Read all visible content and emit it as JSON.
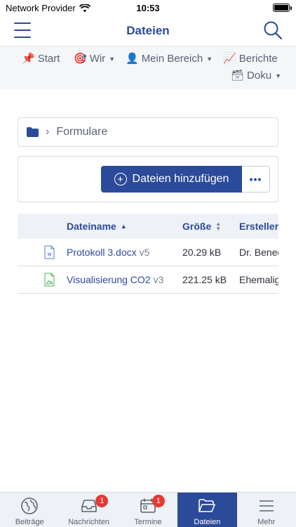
{
  "status_bar": {
    "carrier": "Network Provider",
    "time": "10:53"
  },
  "header": {
    "title": "Dateien"
  },
  "nav": {
    "items": [
      {
        "label": "Start",
        "icon": "📌"
      },
      {
        "label": "Wir",
        "icon": "🎯"
      },
      {
        "label": "Mein Bereich",
        "icon": "👤"
      },
      {
        "label": "Berichte",
        "icon": "📈"
      },
      {
        "label": "Doku",
        "icon": "🗃"
      }
    ]
  },
  "breadcrumb": {
    "current": "Formulare"
  },
  "toolbar": {
    "add_label": "Dateien hinzufügen",
    "more_label": "•••"
  },
  "table": {
    "columns": [
      "Dateiname",
      "Größe",
      "Ersteller"
    ],
    "rows": [
      {
        "name": "Protokoll 3.docx",
        "version": "v5",
        "size": "20.29 kB",
        "creator": "Dr. Benedikt",
        "type": "word"
      },
      {
        "name": "Visualisierung CO2",
        "version": "v3",
        "size": "221.25 kB",
        "creator": "Ehemaliger",
        "type": "image"
      }
    ]
  },
  "tabbar": {
    "tabs": [
      {
        "label": "Beiträge",
        "badge": ""
      },
      {
        "label": "Nachrichten",
        "badge": "1"
      },
      {
        "label": "Termine",
        "badge": "1"
      },
      {
        "label": "Dateien",
        "badge": ""
      },
      {
        "label": "Mehr",
        "badge": ""
      }
    ]
  },
  "colors": {
    "primary": "#2c4a9a",
    "badge": "#e53935",
    "nav_bg": "#f4f6f8"
  }
}
